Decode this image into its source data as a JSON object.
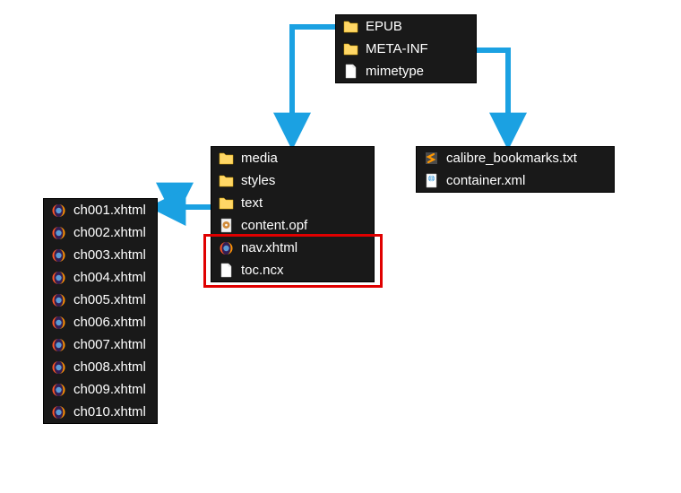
{
  "colors": {
    "panel_bg": "#191919",
    "arrow": "#1ba1e2",
    "highlight": "#e00000"
  },
  "root_panel": {
    "items": [
      {
        "name": "EPUB",
        "icon": "folder"
      },
      {
        "name": "META-INF",
        "icon": "folder"
      },
      {
        "name": "mimetype",
        "icon": "file"
      }
    ]
  },
  "epub_panel": {
    "items": [
      {
        "name": "media",
        "icon": "folder"
      },
      {
        "name": "styles",
        "icon": "folder"
      },
      {
        "name": "text",
        "icon": "folder"
      },
      {
        "name": "content.opf",
        "icon": "opf"
      },
      {
        "name": "nav.xhtml",
        "icon": "firefox"
      },
      {
        "name": "toc.ncx",
        "icon": "file"
      }
    ]
  },
  "metainf_panel": {
    "items": [
      {
        "name": "calibre_bookmarks.txt",
        "icon": "sublime"
      },
      {
        "name": "container.xml",
        "icon": "xml"
      }
    ]
  },
  "text_panel": {
    "items": [
      {
        "name": "ch001.xhtml",
        "icon": "firefox"
      },
      {
        "name": "ch002.xhtml",
        "icon": "firefox"
      },
      {
        "name": "ch003.xhtml",
        "icon": "firefox"
      },
      {
        "name": "ch004.xhtml",
        "icon": "firefox"
      },
      {
        "name": "ch005.xhtml",
        "icon": "firefox"
      },
      {
        "name": "ch006.xhtml",
        "icon": "firefox"
      },
      {
        "name": "ch007.xhtml",
        "icon": "firefox"
      },
      {
        "name": "ch008.xhtml",
        "icon": "firefox"
      },
      {
        "name": "ch009.xhtml",
        "icon": "firefox"
      },
      {
        "name": "ch010.xhtml",
        "icon": "firefox"
      }
    ]
  }
}
